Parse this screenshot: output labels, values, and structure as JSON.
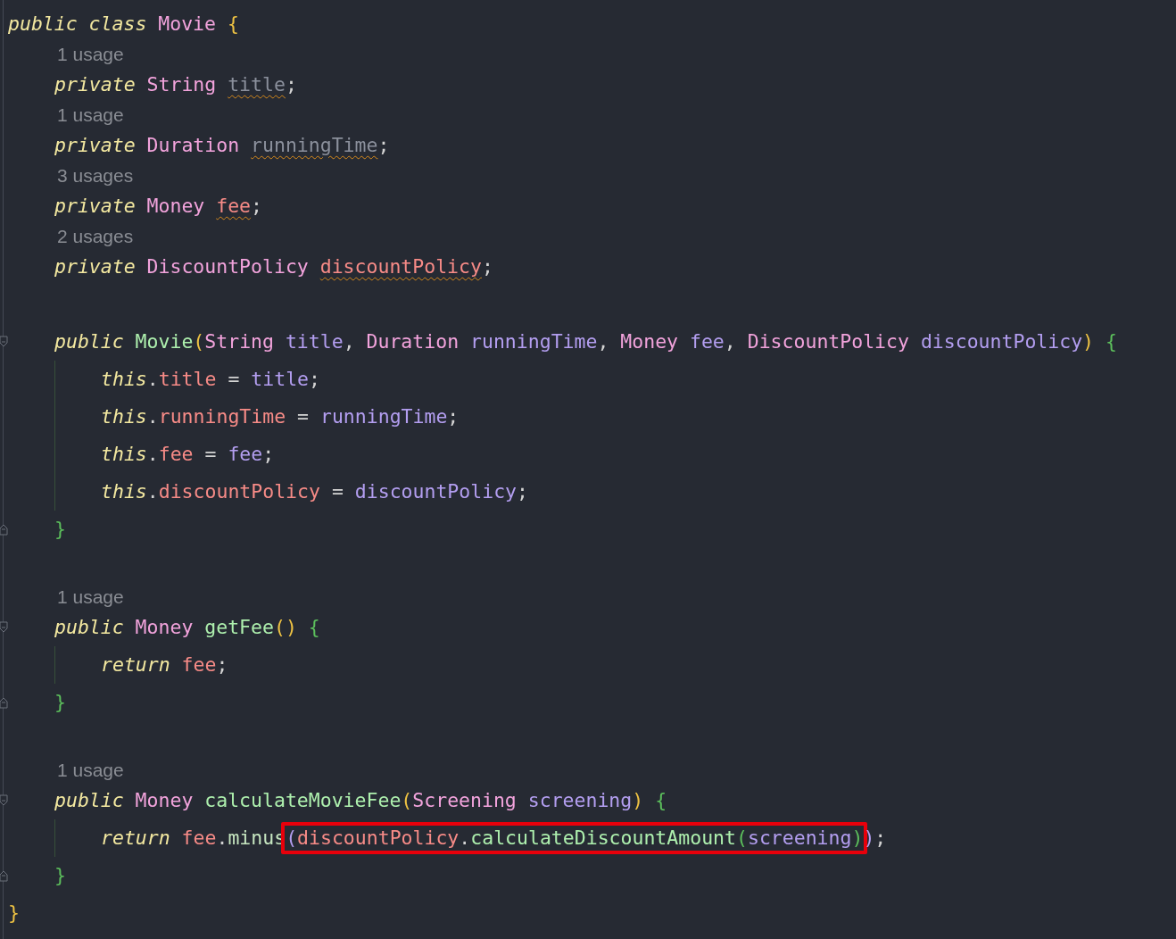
{
  "editor": {
    "lines": [
      {
        "kind": "code",
        "fold_open": false,
        "fold_close": false,
        "tokens": [
          {
            "text": "public ",
            "kind": "keyword"
          },
          {
            "text": "class ",
            "kind": "keyword"
          },
          {
            "text": "Movie ",
            "kind": "type"
          },
          {
            "text": "{",
            "kind": "bracket-gold"
          }
        ],
        "children": [
          {
            "kind": "hint",
            "text": "1 usage"
          },
          {
            "kind": "code",
            "fold_open": false,
            "fold_close": false,
            "tokens": [
              {
                "text": "private ",
                "kind": "keyword"
              },
              {
                "text": "String ",
                "kind": "type"
              },
              {
                "text": "title",
                "kind": "unused",
                "warning": true
              },
              {
                "text": ";",
                "kind": "plain"
              }
            ]
          },
          {
            "kind": "hint",
            "text": "1 usage"
          },
          {
            "kind": "code",
            "fold_open": false,
            "fold_close": false,
            "tokens": [
              {
                "text": "private ",
                "kind": "keyword"
              },
              {
                "text": "Duration ",
                "kind": "type"
              },
              {
                "text": "runningTime",
                "kind": "unused",
                "warning": true
              },
              {
                "text": ";",
                "kind": "plain"
              }
            ]
          },
          {
            "kind": "hint",
            "text": "3 usages"
          },
          {
            "kind": "code",
            "fold_open": false,
            "fold_close": false,
            "tokens": [
              {
                "text": "private ",
                "kind": "keyword"
              },
              {
                "text": "Money ",
                "kind": "type"
              },
              {
                "text": "fee",
                "kind": "field",
                "warning": true
              },
              {
                "text": ";",
                "kind": "plain"
              }
            ]
          },
          {
            "kind": "hint",
            "text": "2 usages"
          },
          {
            "kind": "code",
            "fold_open": false,
            "fold_close": false,
            "tokens": [
              {
                "text": "private ",
                "kind": "keyword"
              },
              {
                "text": "DiscountPolicy ",
                "kind": "type"
              },
              {
                "text": "discountPolicy",
                "kind": "field",
                "warning": true
              },
              {
                "text": ";",
                "kind": "plain"
              }
            ]
          },
          {
            "kind": "blank"
          },
          {
            "kind": "code",
            "fold_open": true,
            "fold_close": false,
            "tokens": [
              {
                "text": "public ",
                "kind": "keyword"
              },
              {
                "text": "Movie",
                "kind": "method"
              },
              {
                "text": "(",
                "kind": "bracket-gold"
              },
              {
                "text": "String ",
                "kind": "type"
              },
              {
                "text": "title",
                "kind": "param"
              },
              {
                "text": ", ",
                "kind": "plain"
              },
              {
                "text": "Duration ",
                "kind": "type"
              },
              {
                "text": "runningTime",
                "kind": "param"
              },
              {
                "text": ", ",
                "kind": "plain"
              },
              {
                "text": "Money ",
                "kind": "type"
              },
              {
                "text": "fee",
                "kind": "param"
              },
              {
                "text": ", ",
                "kind": "plain"
              },
              {
                "text": "DiscountPolicy ",
                "kind": "type"
              },
              {
                "text": "discountPolicy",
                "kind": "param"
              },
              {
                "text": ") ",
                "kind": "bracket-gold"
              },
              {
                "text": "{",
                "kind": "bracket-green"
              }
            ],
            "children": [
              {
                "kind": "code",
                "fold_open": false,
                "fold_close": false,
                "tokens": [
                  {
                    "text": "this",
                    "kind": "keyword"
                  },
                  {
                    "text": ".",
                    "kind": "plain"
                  },
                  {
                    "text": "title",
                    "kind": "field"
                  },
                  {
                    "text": " = ",
                    "kind": "plain"
                  },
                  {
                    "text": "title",
                    "kind": "param"
                  },
                  {
                    "text": ";",
                    "kind": "plain"
                  }
                ]
              },
              {
                "kind": "code",
                "fold_open": false,
                "fold_close": false,
                "tokens": [
                  {
                    "text": "this",
                    "kind": "keyword"
                  },
                  {
                    "text": ".",
                    "kind": "plain"
                  },
                  {
                    "text": "runningTime",
                    "kind": "field"
                  },
                  {
                    "text": " = ",
                    "kind": "plain"
                  },
                  {
                    "text": "runningTime",
                    "kind": "param"
                  },
                  {
                    "text": ";",
                    "kind": "plain"
                  }
                ]
              },
              {
                "kind": "code",
                "fold_open": false,
                "fold_close": false,
                "tokens": [
                  {
                    "text": "this",
                    "kind": "keyword"
                  },
                  {
                    "text": ".",
                    "kind": "plain"
                  },
                  {
                    "text": "fee",
                    "kind": "field"
                  },
                  {
                    "text": " = ",
                    "kind": "plain"
                  },
                  {
                    "text": "fee",
                    "kind": "param"
                  },
                  {
                    "text": ";",
                    "kind": "plain"
                  }
                ]
              },
              {
                "kind": "code",
                "fold_open": false,
                "fold_close": false,
                "tokens": [
                  {
                    "text": "this",
                    "kind": "keyword"
                  },
                  {
                    "text": ".",
                    "kind": "plain"
                  },
                  {
                    "text": "discountPolicy",
                    "kind": "field"
                  },
                  {
                    "text": " = ",
                    "kind": "plain"
                  },
                  {
                    "text": "discountPolicy",
                    "kind": "param"
                  },
                  {
                    "text": ";",
                    "kind": "plain"
                  }
                ]
              }
            ]
          },
          {
            "kind": "code",
            "fold_open": false,
            "fold_close": true,
            "tokens": [
              {
                "text": "}",
                "kind": "bracket-green"
              }
            ]
          },
          {
            "kind": "blank"
          },
          {
            "kind": "hint",
            "text": "1 usage"
          },
          {
            "kind": "code",
            "fold_open": true,
            "fold_close": false,
            "tokens": [
              {
                "text": "public ",
                "kind": "keyword"
              },
              {
                "text": "Money ",
                "kind": "type"
              },
              {
                "text": "getFee",
                "kind": "method"
              },
              {
                "text": "() ",
                "kind": "bracket-gold"
              },
              {
                "text": "{",
                "kind": "bracket-green"
              }
            ],
            "children": [
              {
                "kind": "code",
                "fold_open": false,
                "fold_close": false,
                "tokens": [
                  {
                    "text": "return ",
                    "kind": "keyword"
                  },
                  {
                    "text": "fee",
                    "kind": "field"
                  },
                  {
                    "text": ";",
                    "kind": "plain"
                  }
                ]
              }
            ]
          },
          {
            "kind": "code",
            "fold_open": false,
            "fold_close": true,
            "tokens": [
              {
                "text": "}",
                "kind": "bracket-green"
              }
            ]
          },
          {
            "kind": "blank"
          },
          {
            "kind": "hint",
            "text": "1 usage"
          },
          {
            "kind": "code",
            "fold_open": true,
            "fold_close": false,
            "tokens": [
              {
                "text": "public ",
                "kind": "keyword"
              },
              {
                "text": "Money ",
                "kind": "type"
              },
              {
                "text": "calculateMovieFee",
                "kind": "method"
              },
              {
                "text": "(",
                "kind": "bracket-gold"
              },
              {
                "text": "Screening ",
                "kind": "type"
              },
              {
                "text": "screening",
                "kind": "param"
              },
              {
                "text": ") ",
                "kind": "bracket-gold"
              },
              {
                "text": "{",
                "kind": "bracket-green"
              }
            ],
            "children": [
              {
                "kind": "code",
                "fold_open": false,
                "fold_close": false,
                "tokens": [
                  {
                    "text": "return ",
                    "kind": "keyword"
                  },
                  {
                    "text": "fee",
                    "kind": "field"
                  },
                  {
                    "text": ".",
                    "kind": "plain"
                  },
                  {
                    "text": "minus",
                    "kind": "call"
                  },
                  {
                    "text": "(",
                    "kind": "bracket-purple",
                    "boxed": true
                  },
                  {
                    "text": "discountPolicy",
                    "kind": "field",
                    "boxed": true
                  },
                  {
                    "text": ".",
                    "kind": "plain",
                    "boxed": true
                  },
                  {
                    "text": "calculateDiscountAmount",
                    "kind": "method",
                    "boxed": true
                  },
                  {
                    "text": "(",
                    "kind": "bracket-green",
                    "boxed": true
                  },
                  {
                    "text": "screening",
                    "kind": "param",
                    "boxed": true
                  },
                  {
                    "text": ")",
                    "kind": "bracket-green",
                    "boxed": true
                  },
                  {
                    "text": ")",
                    "kind": "bracket-purple"
                  },
                  {
                    "text": ";",
                    "kind": "plain"
                  }
                ]
              }
            ]
          },
          {
            "kind": "code",
            "fold_open": false,
            "fold_close": true,
            "tokens": [
              {
                "text": "}",
                "kind": "bracket-green"
              }
            ]
          }
        ]
      },
      {
        "kind": "code",
        "fold_open": false,
        "fold_close": false,
        "tokens": [
          {
            "text": "}",
            "kind": "bracket-gold"
          }
        ]
      }
    ]
  }
}
